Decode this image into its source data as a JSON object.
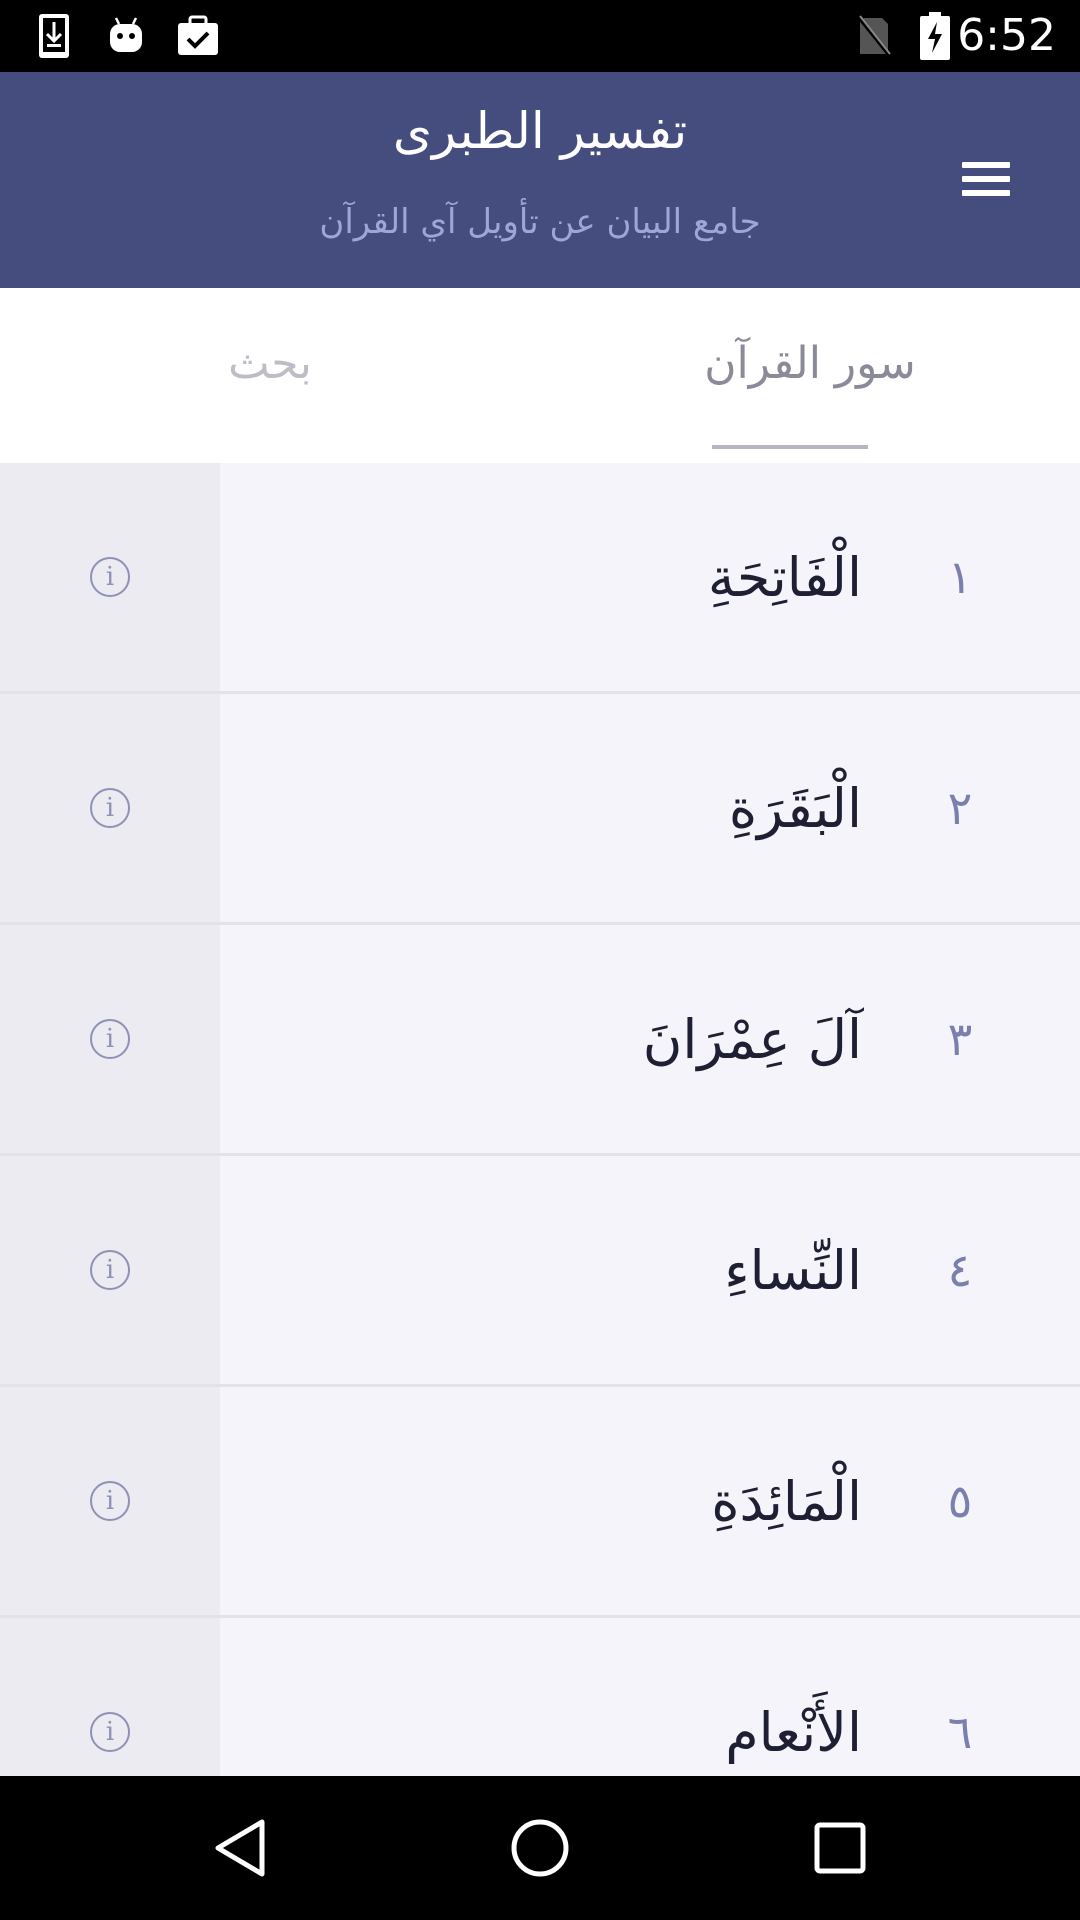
{
  "status_bar": {
    "time": "6:52",
    "icons": [
      "download-icon",
      "android-icon",
      "clipboard-check-icon",
      "no-sim-icon",
      "battery-charging-icon"
    ]
  },
  "app_bar": {
    "title": "تفسير الطبرى",
    "subtitle": "جامع البيان عن تأويل آي القرآن",
    "menu_icon": "hamburger-menu-icon"
  },
  "tabs": [
    {
      "label": "سور القرآن",
      "selected": true
    },
    {
      "label": "بحث",
      "selected": false
    }
  ],
  "suras": [
    {
      "number": "١",
      "name": "الْفَاتِحَةِ"
    },
    {
      "number": "٢",
      "name": "الْبَقَرَةِ"
    },
    {
      "number": "٣",
      "name": "آلَ عِمْرَانَ"
    },
    {
      "number": "٤",
      "name": "النِّساءِ"
    },
    {
      "number": "٥",
      "name": "الْمَائِدَةِ"
    },
    {
      "number": "٦",
      "name": "الأَنْعام"
    }
  ],
  "info_icon_glyph": "i",
  "colors": {
    "app_bar": "#454c7e",
    "subtitle": "#9fa6d6",
    "list_bg": "#f4f4fa",
    "info_cell_bg": "#ebebf1",
    "number_color": "#7b7fae"
  },
  "nav_bar": {
    "icons": [
      "back-icon",
      "home-icon",
      "recents-icon"
    ]
  }
}
